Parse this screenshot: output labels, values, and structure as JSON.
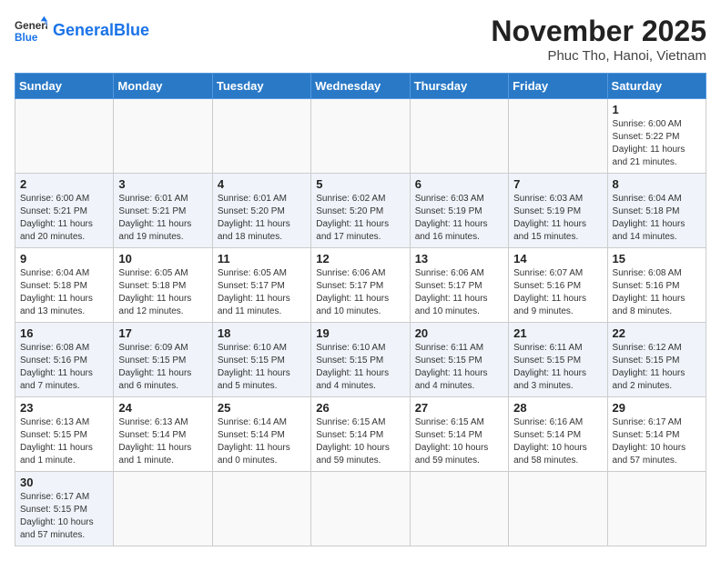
{
  "header": {
    "logo_general": "General",
    "logo_blue": "Blue",
    "title": "November 2025",
    "location": "Phuc Tho, Hanoi, Vietnam"
  },
  "weekdays": [
    "Sunday",
    "Monday",
    "Tuesday",
    "Wednesday",
    "Thursday",
    "Friday",
    "Saturday"
  ],
  "weeks": [
    [
      {
        "day": "",
        "info": ""
      },
      {
        "day": "",
        "info": ""
      },
      {
        "day": "",
        "info": ""
      },
      {
        "day": "",
        "info": ""
      },
      {
        "day": "",
        "info": ""
      },
      {
        "day": "",
        "info": ""
      },
      {
        "day": "1",
        "info": "Sunrise: 6:00 AM\nSunset: 5:22 PM\nDaylight: 11 hours\nand 21 minutes."
      }
    ],
    [
      {
        "day": "2",
        "info": "Sunrise: 6:00 AM\nSunset: 5:21 PM\nDaylight: 11 hours\nand 20 minutes."
      },
      {
        "day": "3",
        "info": "Sunrise: 6:01 AM\nSunset: 5:21 PM\nDaylight: 11 hours\nand 19 minutes."
      },
      {
        "day": "4",
        "info": "Sunrise: 6:01 AM\nSunset: 5:20 PM\nDaylight: 11 hours\nand 18 minutes."
      },
      {
        "day": "5",
        "info": "Sunrise: 6:02 AM\nSunset: 5:20 PM\nDaylight: 11 hours\nand 17 minutes."
      },
      {
        "day": "6",
        "info": "Sunrise: 6:03 AM\nSunset: 5:19 PM\nDaylight: 11 hours\nand 16 minutes."
      },
      {
        "day": "7",
        "info": "Sunrise: 6:03 AM\nSunset: 5:19 PM\nDaylight: 11 hours\nand 15 minutes."
      },
      {
        "day": "8",
        "info": "Sunrise: 6:04 AM\nSunset: 5:18 PM\nDaylight: 11 hours\nand 14 minutes."
      }
    ],
    [
      {
        "day": "9",
        "info": "Sunrise: 6:04 AM\nSunset: 5:18 PM\nDaylight: 11 hours\nand 13 minutes."
      },
      {
        "day": "10",
        "info": "Sunrise: 6:05 AM\nSunset: 5:18 PM\nDaylight: 11 hours\nand 12 minutes."
      },
      {
        "day": "11",
        "info": "Sunrise: 6:05 AM\nSunset: 5:17 PM\nDaylight: 11 hours\nand 11 minutes."
      },
      {
        "day": "12",
        "info": "Sunrise: 6:06 AM\nSunset: 5:17 PM\nDaylight: 11 hours\nand 10 minutes."
      },
      {
        "day": "13",
        "info": "Sunrise: 6:06 AM\nSunset: 5:17 PM\nDaylight: 11 hours\nand 10 minutes."
      },
      {
        "day": "14",
        "info": "Sunrise: 6:07 AM\nSunset: 5:16 PM\nDaylight: 11 hours\nand 9 minutes."
      },
      {
        "day": "15",
        "info": "Sunrise: 6:08 AM\nSunset: 5:16 PM\nDaylight: 11 hours\nand 8 minutes."
      }
    ],
    [
      {
        "day": "16",
        "info": "Sunrise: 6:08 AM\nSunset: 5:16 PM\nDaylight: 11 hours\nand 7 minutes."
      },
      {
        "day": "17",
        "info": "Sunrise: 6:09 AM\nSunset: 5:15 PM\nDaylight: 11 hours\nand 6 minutes."
      },
      {
        "day": "18",
        "info": "Sunrise: 6:10 AM\nSunset: 5:15 PM\nDaylight: 11 hours\nand 5 minutes."
      },
      {
        "day": "19",
        "info": "Sunrise: 6:10 AM\nSunset: 5:15 PM\nDaylight: 11 hours\nand 4 minutes."
      },
      {
        "day": "20",
        "info": "Sunrise: 6:11 AM\nSunset: 5:15 PM\nDaylight: 11 hours\nand 4 minutes."
      },
      {
        "day": "21",
        "info": "Sunrise: 6:11 AM\nSunset: 5:15 PM\nDaylight: 11 hours\nand 3 minutes."
      },
      {
        "day": "22",
        "info": "Sunrise: 6:12 AM\nSunset: 5:15 PM\nDaylight: 11 hours\nand 2 minutes."
      }
    ],
    [
      {
        "day": "23",
        "info": "Sunrise: 6:13 AM\nSunset: 5:15 PM\nDaylight: 11 hours\nand 1 minute."
      },
      {
        "day": "24",
        "info": "Sunrise: 6:13 AM\nSunset: 5:14 PM\nDaylight: 11 hours\nand 1 minute."
      },
      {
        "day": "25",
        "info": "Sunrise: 6:14 AM\nSunset: 5:14 PM\nDaylight: 11 hours\nand 0 minutes."
      },
      {
        "day": "26",
        "info": "Sunrise: 6:15 AM\nSunset: 5:14 PM\nDaylight: 10 hours\nand 59 minutes."
      },
      {
        "day": "27",
        "info": "Sunrise: 6:15 AM\nSunset: 5:14 PM\nDaylight: 10 hours\nand 59 minutes."
      },
      {
        "day": "28",
        "info": "Sunrise: 6:16 AM\nSunset: 5:14 PM\nDaylight: 10 hours\nand 58 minutes."
      },
      {
        "day": "29",
        "info": "Sunrise: 6:17 AM\nSunset: 5:14 PM\nDaylight: 10 hours\nand 57 minutes."
      }
    ],
    [
      {
        "day": "30",
        "info": "Sunrise: 6:17 AM\nSunset: 5:15 PM\nDaylight: 10 hours\nand 57 minutes."
      },
      {
        "day": "",
        "info": ""
      },
      {
        "day": "",
        "info": ""
      },
      {
        "day": "",
        "info": ""
      },
      {
        "day": "",
        "info": ""
      },
      {
        "day": "",
        "info": ""
      },
      {
        "day": "",
        "info": ""
      }
    ]
  ]
}
